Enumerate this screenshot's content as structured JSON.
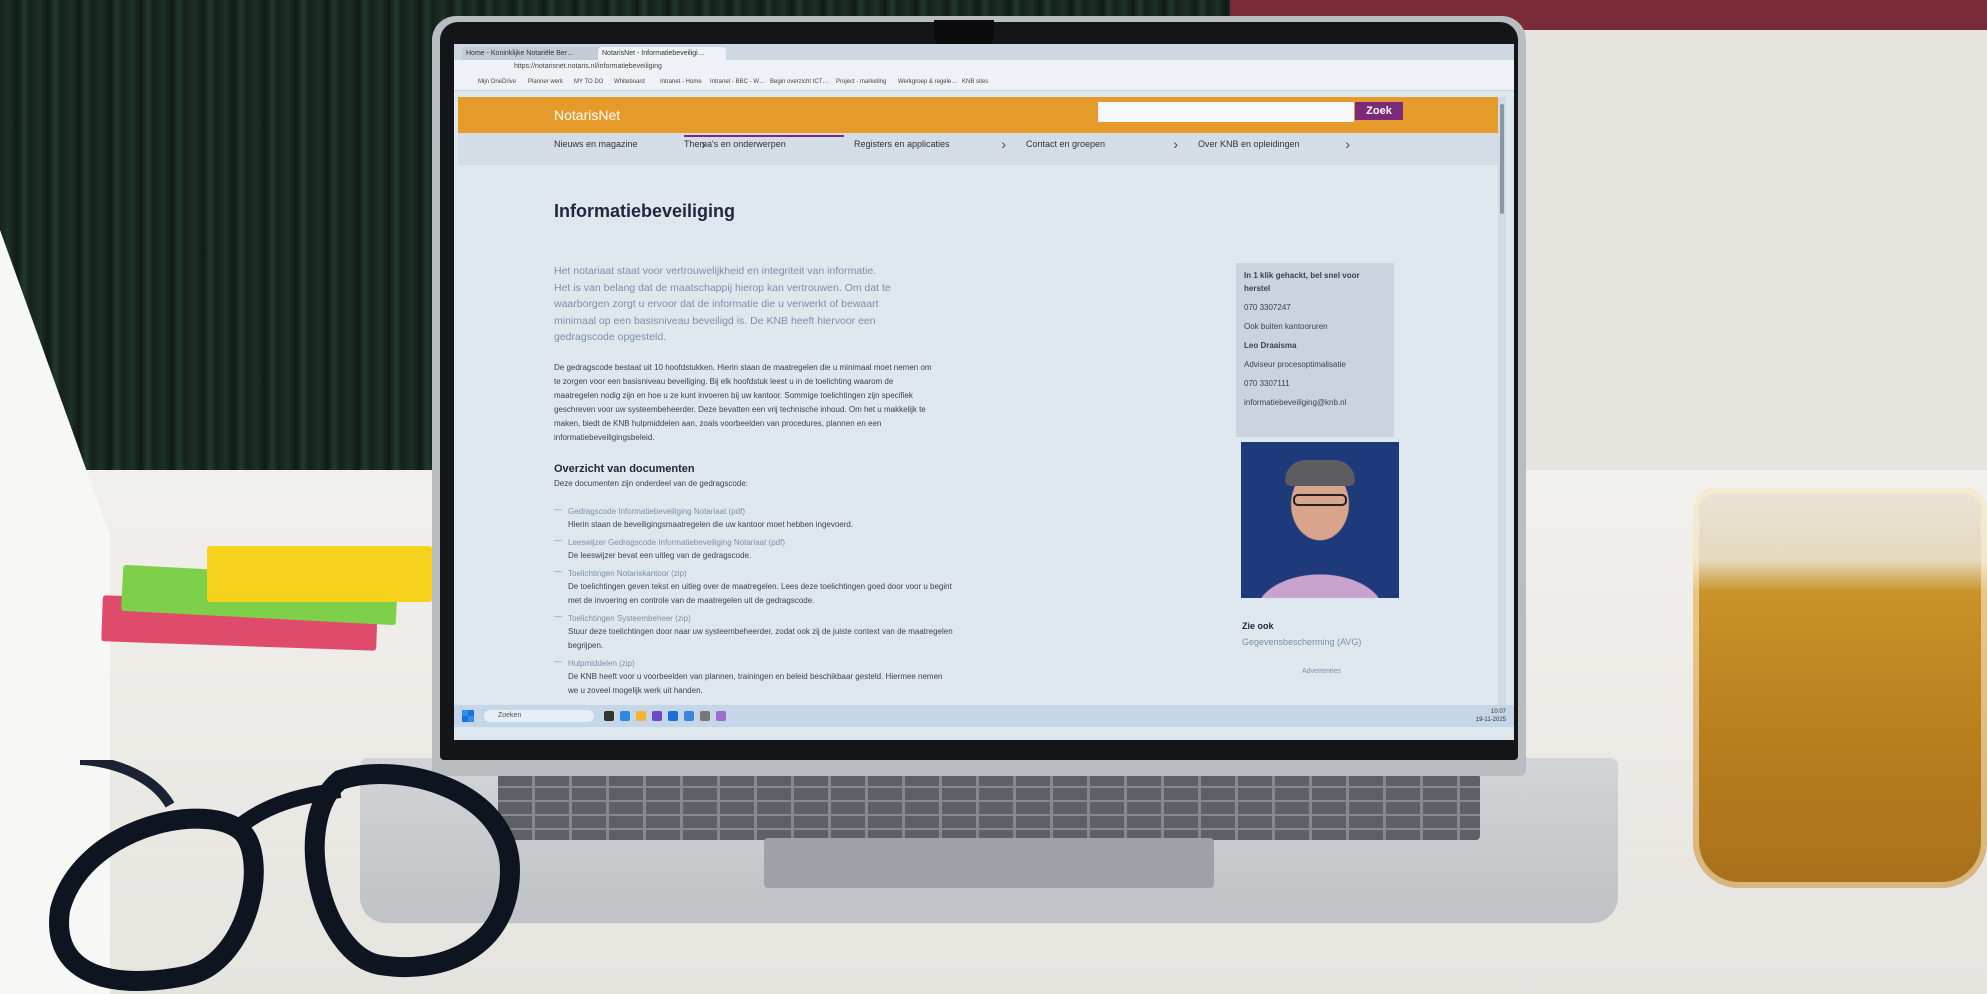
{
  "browser": {
    "tabs": [
      "Home - Koninklijke Notariële Ber…",
      "NotarisNet - Informatiebeveiligi…"
    ],
    "url": "https://notarisnet.notaris.nl/informatiebeveiliging",
    "bookmarks": [
      "Mijn OneDrive",
      "Planner werk",
      "MY TO DO",
      "Whiteboard",
      "Intranet - Home",
      "Intranet - BBC - W…",
      "Begin overzicht ICT…",
      "Project - marketing",
      "Werkgroep & regele…",
      "KNB sites"
    ]
  },
  "site": {
    "logo": "NotarisNet",
    "search_button": "Zoek"
  },
  "nav": [
    {
      "label": "Nieuws en magazine"
    },
    {
      "label": "Thema's en onderwerpen"
    },
    {
      "label": "Registers en applicaties"
    },
    {
      "label": "Contact en groepen"
    },
    {
      "label": "Over KNB en opleidingen"
    }
  ],
  "content": {
    "title": "Informatiebeveiliging",
    "intro": "Het notariaat staat voor vertrouwelijkheid en integriteit van informatie. Het is van belang dat de maatschappij hierop kan vertrouwen. Om dat te waarborgen zorgt u ervoor dat de informatie die u verwerkt of bewaart minimaal op een basisniveau beveiligd is. De KNB heeft hiervoor een gedragscode opgesteld.",
    "paragraph": "De gedragscode bestaat uit 10 hoofdstukken. Hierin staan de maatregelen die u minimaal moet nemen om te zorgen voor een basisniveau beveiliging. Bij elk hoofdstuk leest u in de toelichting waarom de maatregelen nodig zijn en hoe u ze kunt invoeren bij uw kantoor. Sommige toelichtingen zijn specifiek geschreven voor uw systeembeheerder. Deze bevatten een vrij technische inhoud. Om het u makkelijk te maken, biedt de KNB hulpmiddelen aan, zoals voorbeelden van procedures, plannen en een informatiebeveiligingsbeleid.",
    "docs_heading": "Overzicht van documenten",
    "docs_subheading": "Deze documenten zijn onderdeel van de gedragscode:",
    "docs": [
      {
        "link": "Gedragscode Informatiebeveiliging Notariaat (pdf)",
        "desc": "Hierin staan de beveiligingsmaatregelen die uw kantoor moet hebben ingevoerd."
      },
      {
        "link": "Leeswijzer Gedragscode Informatiebeveiliging Notariaat (pdf)",
        "desc": "De leeswijzer bevat een uitleg van de gedragscode."
      },
      {
        "link": "Toelichtingen Notariskantoor (zip)",
        "desc": "De toelichtingen geven tekst en uitleg over de maatregelen. Lees deze toelichtingen goed door voor u begint met de invoering en controle van de maatregelen uit de gedragscode."
      },
      {
        "link": "Toelichtingen Systeembeheer (zip)",
        "desc": "Stuur deze toelichtingen door naar uw systeembeheerder, zodat ook zij de juiste context van de maatregelen begrijpen."
      },
      {
        "link": "Hulpmiddelen (zip)",
        "desc": "De KNB heeft voor u voorbeelden van plannen, trainingen en beleid beschikbaar gesteld. Hiermee nemen we u zoveel mogelijk werk uit handen."
      }
    ]
  },
  "sidebar": {
    "alert_title": "In 1 klik gehackt, bel snel voor herstel",
    "alert_phone": "070 3307247",
    "alert_note": "Ook buiten kantooruren",
    "contact_name": "Leo Draaisma",
    "contact_role": "Adviseur procesoptimalisatie",
    "contact_phone": "070 3307111",
    "contact_email": "informatiebeveiliging@knb.nl",
    "see_also_title": "Zie ook",
    "see_also_link": "Gegevensbescherming (AVG)",
    "ads_label": "Advertenties"
  },
  "taskbar": {
    "search": "Zoeken",
    "time": "10:07",
    "date": "19-11-2025"
  }
}
